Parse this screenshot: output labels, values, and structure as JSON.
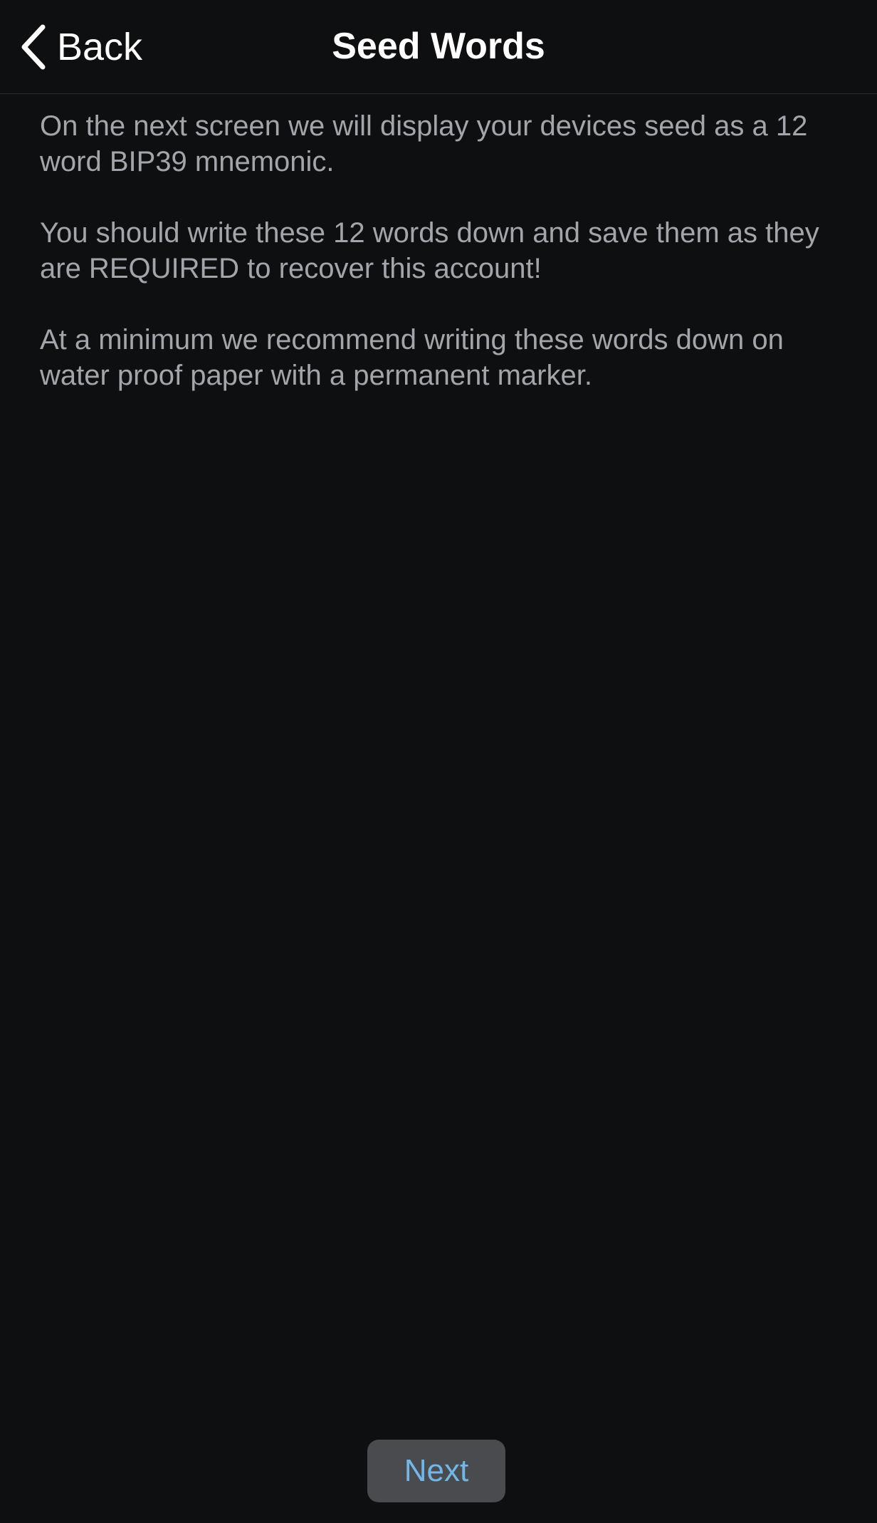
{
  "nav": {
    "back_label": "Back",
    "title": "Seed Words",
    "back_icon": "chevron-left-icon"
  },
  "body": {
    "paragraphs": [
      "On the next screen we will display your devices seed as a 12 word BIP39 mnemonic.",
      "You should write these 12 words down and save them as they are REQUIRED to recover this account!",
      "At a minimum we recommend writing these words down on water proof paper with a permanent marker."
    ]
  },
  "footer": {
    "next_label": "Next"
  },
  "colors": {
    "background": "#0e0f11",
    "text": "#a3a5aa",
    "title": "#ffffff",
    "button_bg": "#4a4b4f",
    "button_text": "#73b7e8"
  }
}
